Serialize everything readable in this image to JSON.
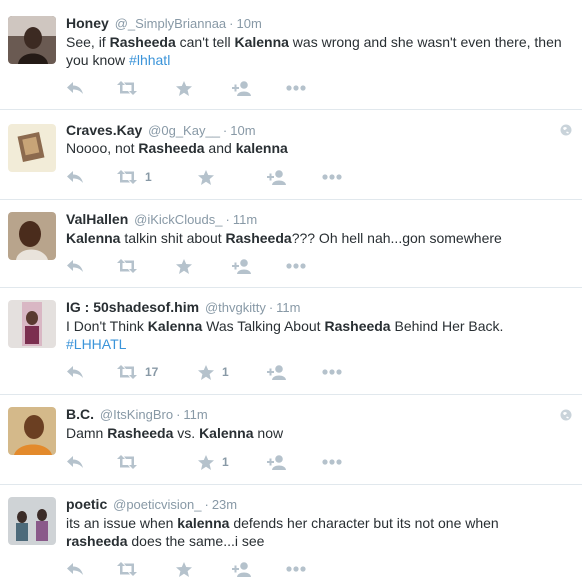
{
  "colors": {
    "accent": "#3b94d9",
    "muted": "#8899a6",
    "icon": "#b5c2cc",
    "text": "#292f33",
    "border": "#e1e8ed"
  },
  "tweets": [
    {
      "fullname": "Honey",
      "username": "@_SimplyBriannaa",
      "time": "10m",
      "text_parts": [
        {
          "t": "See, if ",
          "b": false
        },
        {
          "t": "Rasheeda",
          "b": true
        },
        {
          "t": " can't tell ",
          "b": false
        },
        {
          "t": "Kalenna",
          "b": true
        },
        {
          "t": " was wrong and she wasn't even there, then you know ",
          "b": false
        },
        {
          "t": "#lhhatl",
          "tag": true
        }
      ],
      "retweets": "",
      "favorites": "",
      "geo_icon": false
    },
    {
      "fullname": "Craves.Kay",
      "username": "@0g_Kay__",
      "time": "10m",
      "text_parts": [
        {
          "t": "Noooo, not ",
          "b": false
        },
        {
          "t": "Rasheeda",
          "b": true
        },
        {
          "t": " and ",
          "b": false
        },
        {
          "t": "kalenna",
          "b": true
        }
      ],
      "retweets": "1",
      "favorites": "",
      "geo_icon": true
    },
    {
      "fullname": "ValHallen",
      "username": "@iKickClouds_",
      "time": "11m",
      "text_parts": [
        {
          "t": "Kalenna",
          "b": true
        },
        {
          "t": " talkin shit about ",
          "b": false
        },
        {
          "t": "Rasheeda",
          "b": true
        },
        {
          "t": "??? Oh hell nah...gon somewhere",
          "b": false
        }
      ],
      "retweets": "",
      "favorites": "",
      "geo_icon": false
    },
    {
      "fullname": "IG : 50shadesof.him",
      "username": "@thvgkitty",
      "time": "11m",
      "text_parts": [
        {
          "t": "I Don't Think ",
          "b": false
        },
        {
          "t": "Kalenna",
          "b": true
        },
        {
          "t": " Was Talking About ",
          "b": false
        },
        {
          "t": "Rasheeda",
          "b": true
        },
        {
          "t": " Behind Her Back. ",
          "b": false
        },
        {
          "t": "#LHHATL",
          "tag": true
        }
      ],
      "retweets": "17",
      "favorites": "1",
      "geo_icon": false
    },
    {
      "fullname": "B.C.",
      "username": "@ItsKingBro",
      "time": "11m",
      "text_parts": [
        {
          "t": "Damn ",
          "b": false
        },
        {
          "t": "Rasheeda",
          "b": true
        },
        {
          "t": " vs. ",
          "b": false
        },
        {
          "t": "Kalenna",
          "b": true
        },
        {
          "t": " now",
          "b": false
        }
      ],
      "retweets": "",
      "favorites": "1",
      "geo_icon": true
    },
    {
      "fullname": "poetic",
      "username": "@poeticvision_",
      "time": "23m",
      "text_parts": [
        {
          "t": "its an issue when ",
          "b": false
        },
        {
          "t": "kalenna",
          "b": true
        },
        {
          "t": " defends her character but its not one when ",
          "b": false
        },
        {
          "t": "rasheeda",
          "b": true
        },
        {
          "t": " does the same...i see",
          "b": false
        }
      ],
      "retweets": "",
      "favorites": "",
      "geo_icon": false
    }
  ]
}
